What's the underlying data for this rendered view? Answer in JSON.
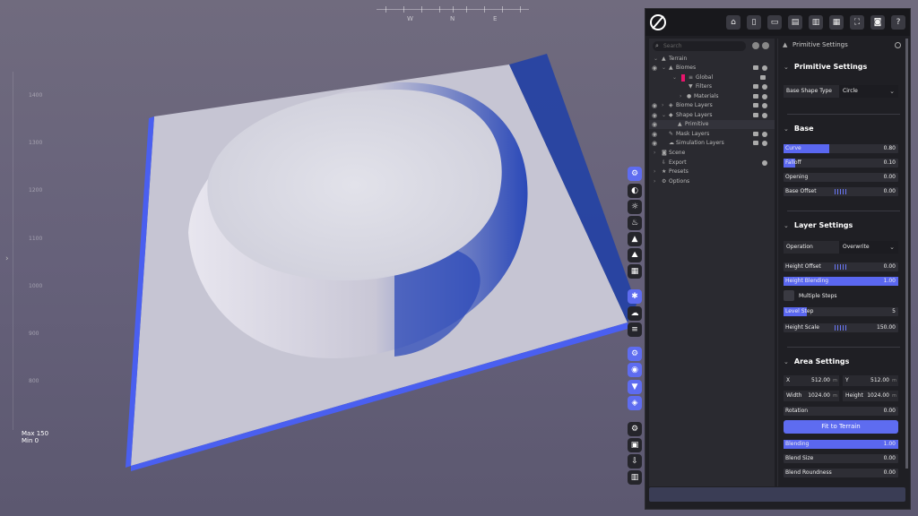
{
  "compass": {
    "w": "W",
    "n": "N",
    "e": "E"
  },
  "ruler": [
    "1400",
    "1300",
    "1200",
    "1100",
    "1000",
    "900",
    "800"
  ],
  "height_readout": {
    "max": "Max 150",
    "min": "Min 0"
  },
  "viewport_tools": [
    "gear-icon",
    "moon-icon",
    "sun-icon",
    "fire-icon",
    "mountain-icon",
    "landscape-icon",
    "grid-icon",
    "settings-icon",
    "cloud-icon",
    "menu-icon",
    "gears-icon",
    "eye-icon",
    "filter-icon",
    "layers-icon",
    "gear-icon",
    "folder-icon",
    "download-icon",
    "chart-icon"
  ],
  "toolbar": {
    "icons": [
      "home-icon",
      "new-file-icon",
      "open-folder-icon",
      "save-icon",
      "save-as-icon",
      "export-icon",
      "fullscreen-icon",
      "camera-icon",
      "help-icon"
    ]
  },
  "tree": {
    "search_placeholder": "Search",
    "items": [
      {
        "label": "Terrain"
      },
      {
        "label": "Biomes"
      },
      {
        "label": "Global"
      },
      {
        "label": "Filters"
      },
      {
        "label": "Materials"
      },
      {
        "label": "Biome Layers"
      },
      {
        "label": "Shape Layers"
      },
      {
        "label": "Primitive"
      },
      {
        "label": "Mask Layers"
      },
      {
        "label": "Simulation Layers"
      },
      {
        "label": "Scene"
      },
      {
        "label": "Export"
      },
      {
        "label": "Presets"
      },
      {
        "label": "Options"
      }
    ]
  },
  "props": {
    "header": "Primitive Settings",
    "primitive": {
      "title": "Primitive Settings",
      "shape_label": "Base Shape Type",
      "shape_value": "Circle"
    },
    "base": {
      "title": "Base",
      "curve": {
        "label": "Curve",
        "value": "0.80",
        "fill": 0.4
      },
      "falloff": {
        "label": "Falloff",
        "value": "0.10",
        "fill": 0.1
      },
      "opening": {
        "label": "Opening",
        "value": "0.00"
      },
      "offset": {
        "label": "Base Offset",
        "value": "0.00"
      }
    },
    "layer": {
      "title": "Layer Settings",
      "operation_label": "Operation",
      "operation_value": "Overwrite",
      "height_offset": {
        "label": "Height Offset",
        "value": "0.00"
      },
      "height_blending": {
        "label": "Height Blending",
        "value": "1.00",
        "fill": 1.0
      },
      "multiple_steps": "Multiple Steps",
      "level_step": {
        "label": "Level Step",
        "value": "5",
        "fill": 0.2
      },
      "height_scale": {
        "label": "Height Scale",
        "value": "150.00"
      }
    },
    "area": {
      "title": "Area Settings",
      "x": {
        "label": "X",
        "value": "512.00",
        "unit": "m"
      },
      "y": {
        "label": "Y",
        "value": "512.00",
        "unit": "m"
      },
      "width": {
        "label": "Width",
        "value": "1024.00",
        "unit": "m"
      },
      "height": {
        "label": "Height",
        "value": "1024.00",
        "unit": "m"
      },
      "rotation": {
        "label": "Rotation",
        "value": "0.00"
      },
      "fit_button": "Fit to Terrain",
      "blending": {
        "label": "Blending",
        "value": "1.00",
        "fill": 1.0
      },
      "blend_size": {
        "label": "Blend Size",
        "value": "0.00"
      },
      "blend_roundness": {
        "label": "Blend Roundness",
        "value": "0.00"
      }
    }
  }
}
